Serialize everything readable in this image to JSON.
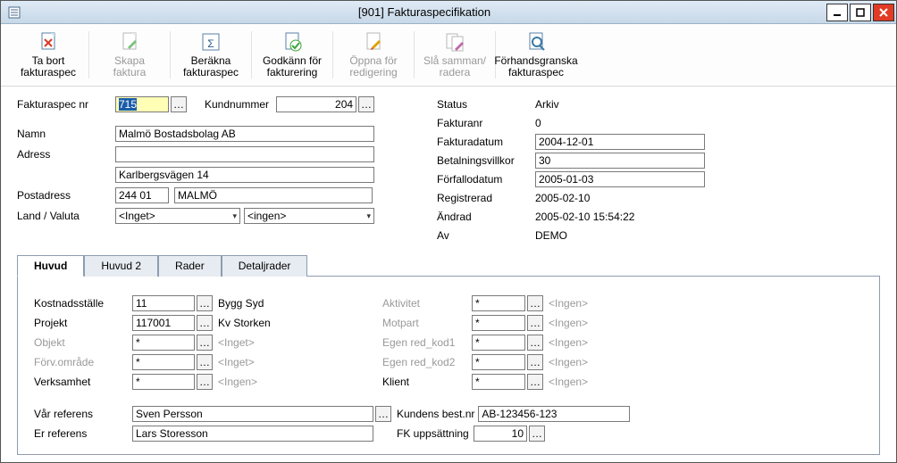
{
  "window": {
    "title": "[901]  Fakturaspecifikation"
  },
  "toolbar": {
    "tabort": {
      "line1": "Ta bort",
      "line2": "fakturaspec"
    },
    "skapa": {
      "line1": "Skapa",
      "line2": "faktura"
    },
    "berakna": {
      "line1": "Beräkna",
      "line2": "fakturaspec"
    },
    "godkann": {
      "line1": "Godkänn för",
      "line2": "fakturering"
    },
    "oppna": {
      "line1": "Öppna för",
      "line2": "redigering"
    },
    "sla": {
      "line1": "Slå samman/",
      "line2": "radera"
    },
    "forhand": {
      "line1": "Förhandsgranska",
      "line2": "fakturaspec"
    }
  },
  "header": {
    "fakturaspec_nr_label": "Fakturaspec nr",
    "fakturaspec_nr": "715",
    "kundnummer_label": "Kundnummer",
    "kundnummer": "204",
    "namn_label": "Namn",
    "namn": "Malmö Bostadsbolag AB",
    "adress_label": "Adress",
    "adress1": "",
    "adress2": "Karlbergsvägen 14",
    "postadress_label": "Postadress",
    "postnr": "244 01",
    "postort": "MALMÖ",
    "landvaluta_label": "Land / Valuta",
    "land": "<Inget>",
    "valuta": "<ingen>"
  },
  "right": {
    "status_label": "Status",
    "status": "Arkiv",
    "fakturanr_label": "Fakturanr",
    "fakturanr": "0",
    "fakturadatum_label": "Fakturadatum",
    "fakturadatum": "2004-12-01",
    "betal_label": "Betalningsvillkor",
    "betal": "30",
    "forfall_label": "Förfallodatum",
    "forfall": "2005-01-03",
    "reg_label": "Registrerad",
    "reg": "2005-02-10",
    "andrad_label": "Ändrad",
    "andrad": "2005-02-10 15:54:22",
    "av_label": "Av",
    "av": "DEMO"
  },
  "tabs": {
    "huvud": "Huvud",
    "huvud2": "Huvud 2",
    "rader": "Rader",
    "detalj": "Detaljrader"
  },
  "huvud": {
    "kostnad_label": "Kostnadsställe",
    "kostnad": "11",
    "kostnad_txt": "Bygg Syd",
    "projekt_label": "Projekt",
    "projekt": "117001",
    "projekt_txt": "Kv Storken",
    "objekt_label": "Objekt",
    "objekt": "*",
    "objekt_txt": "<Inget>",
    "forv_label": "Förv.område",
    "forv": "*",
    "forv_txt": "<Inget>",
    "verk_label": "Verksamhet",
    "verk": "*",
    "verk_txt": "<Ingen>",
    "aktiv_label": "Aktivitet",
    "aktiv": "*",
    "aktiv_txt": "<Ingen>",
    "motpart_label": "Motpart",
    "motpart": "*",
    "motpart_txt": "<Ingen>",
    "egen1_label": "Egen red_kod1",
    "egen1": "*",
    "egen1_txt": "<Ingen>",
    "egen2_label": "Egen red_kod2",
    "egen2": "*",
    "egen2_txt": "<Ingen>",
    "klient_label": "Klient",
    "klient": "*",
    "klient_txt": "<Ingen>",
    "varref_label": "Vår referens",
    "varref": "Sven Persson",
    "kundbest_label": "Kundens best.nr",
    "kundbest": "AB-123456-123",
    "erref_label": "Er referens",
    "erref": "Lars Storesson",
    "fkupp_label": "FK uppsättning",
    "fkupp": "10"
  },
  "ingen": "<Ingen>"
}
